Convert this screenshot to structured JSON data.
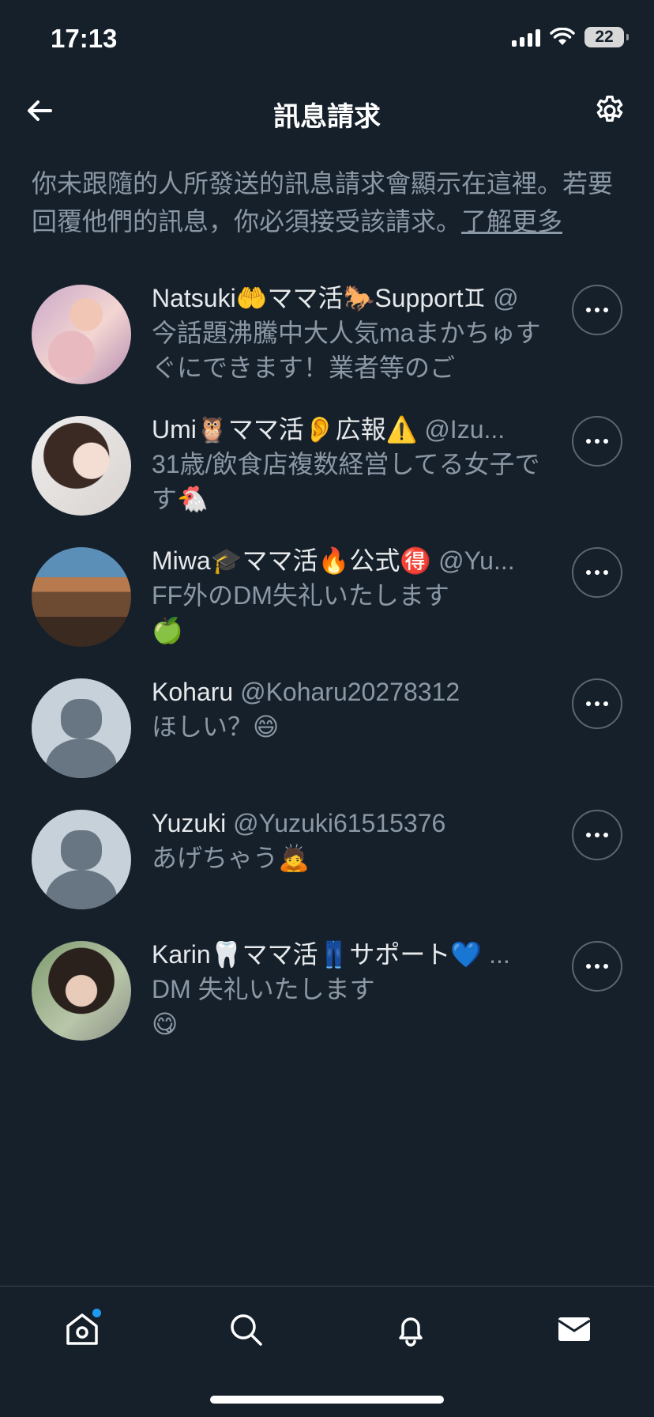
{
  "status_bar": {
    "time": "17:13",
    "battery": "22"
  },
  "header": {
    "title": "訊息請求"
  },
  "description": {
    "text": "你未跟隨的人所發送的訊息請求會顯示在這裡。若要回覆他們的訊息，你必須接受該請求。",
    "link": "了解更多"
  },
  "requests": [
    {
      "name": "Natsuki🤲ママ活🐎Support♊",
      "handle": "@",
      "preview": "今話題沸騰中大人気maまかちゅすぐにできます！業者等のご",
      "avatar": "photo"
    },
    {
      "name": "Umi🦉ママ活👂広報⚠️",
      "handle": "@Izu...",
      "preview": "31歳/飲食店複数経営してる女子です🐔",
      "avatar": "photo"
    },
    {
      "name": "Miwa🎓ママ活🔥公式🉐",
      "handle": "@Yu...",
      "preview": "FF外のDM失礼いたします\n🍏",
      "avatar": "photo"
    },
    {
      "name": "Koharu",
      "handle": "@Koharu20278312",
      "preview": "ほしい？😄",
      "avatar": "default"
    },
    {
      "name": "Yuzuki",
      "handle": "@Yuzuki61515376",
      "preview": "あげちゃう🙇",
      "avatar": "default"
    },
    {
      "name": "Karin🦷ママ活👖サポート💙",
      "handle": "...",
      "preview": "DM 失礼いたします\n😋",
      "avatar": "photo"
    }
  ],
  "icons": {
    "back": "arrow-left-icon",
    "settings": "gear-icon",
    "more": "more-horizontal-icon",
    "home": "home-icon",
    "search": "search-icon",
    "notifications": "bell-icon",
    "messages": "envelope-icon"
  },
  "colors": {
    "background": "#15202b",
    "text_primary": "#e7e9ea",
    "text_secondary": "#8b98a5",
    "accent": "#1d9bf0",
    "divider": "#38444d"
  }
}
